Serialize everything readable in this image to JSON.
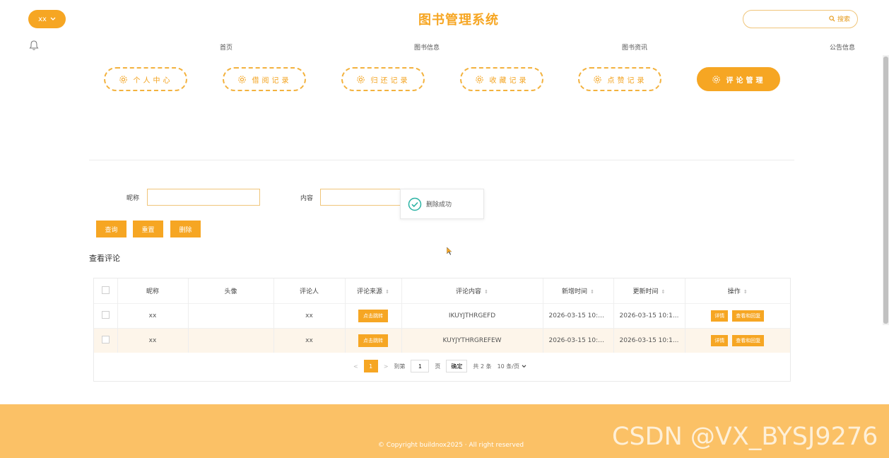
{
  "header": {
    "user_label": "xx",
    "site_title": "图书管理系统",
    "search_label": "搜索",
    "search_placeholder": ""
  },
  "nav": [
    "首页",
    "图书信息",
    "图书资讯",
    "公告信息"
  ],
  "menu": [
    {
      "label": "个人中心",
      "active": false
    },
    {
      "label": "借阅记录",
      "active": false
    },
    {
      "label": "归还记录",
      "active": false
    },
    {
      "label": "收藏记录",
      "active": false
    },
    {
      "label": "点赞记录",
      "active": false
    },
    {
      "label": "评论管理",
      "active": true
    }
  ],
  "filter": {
    "nickname_label": "昵称",
    "nickname_value": "",
    "content_label": "内容",
    "content_value": "",
    "query_btn": "查询",
    "reset_btn": "重置",
    "delete_btn": "删除"
  },
  "toast": {
    "text": "删除成功"
  },
  "section_title": "查看评论",
  "table": {
    "headers": [
      "昵称",
      "头像",
      "评论人",
      "评论来源",
      "评论内容",
      "新增时间",
      "更新时间",
      "操作"
    ],
    "rows": [
      {
        "nickname": "xx",
        "avatar": "",
        "commenter": "xx",
        "source_btn": "点击跳转",
        "content": "IKUYJTHRGEFD",
        "created": "2026-03-15 10:1...",
        "updated": "2026-03-15 10:1...",
        "op_detail": "详情",
        "op_reply": "查看和回复"
      },
      {
        "nickname": "xx",
        "avatar": "",
        "commenter": "xx",
        "source_btn": "点击跳转",
        "content": "KUYJYTHRGREFEW",
        "created": "2026-03-15 10:1...",
        "updated": "2026-03-15 10:1...",
        "op_detail": "详情",
        "op_reply": "查看和回复"
      }
    ]
  },
  "pager": {
    "prev": "<",
    "current_page": "1",
    "next": ">",
    "goto_label": "到第",
    "goto_value": "1",
    "page_unit": "页",
    "confirm": "确定",
    "total": "共 2 条",
    "page_size": "10 条/页"
  },
  "footer": {
    "copyright": "© Copyright buildnox2025 · All right reserved"
  },
  "watermark": "CSDN @VX_BYSJ9276",
  "colors": {
    "accent": "#f6a623",
    "footer": "#fbc166"
  }
}
